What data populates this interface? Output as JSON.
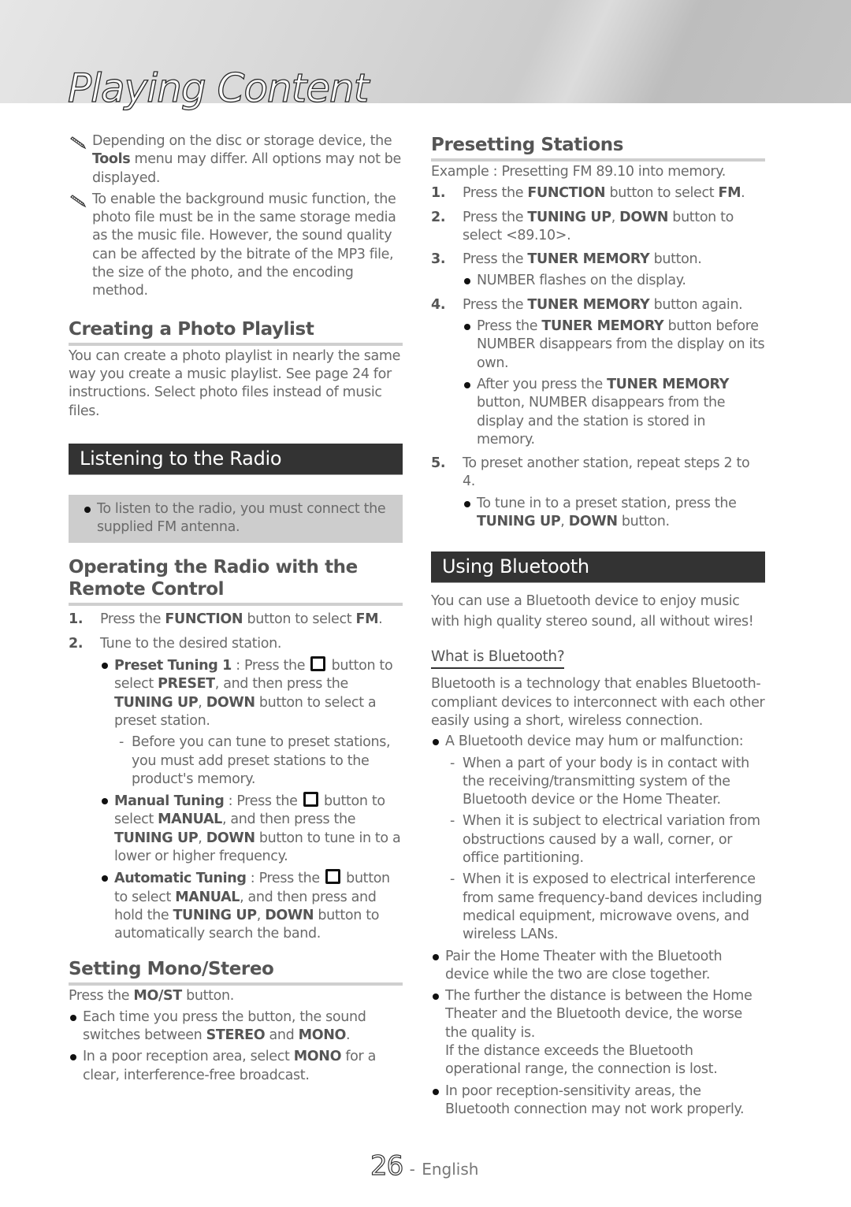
{
  "header": {
    "title": "Playing Content"
  },
  "left": {
    "notes": [
      {
        "parts": [
          [
            "Depending on the disc or storage device, the ",
            ""
          ],
          [
            "Tools",
            "b"
          ],
          [
            " menu may differ. All options may not be displayed.",
            ""
          ]
        ]
      },
      {
        "parts": [
          [
            "To enable the background music function, the photo file must be in the same storage media as the music file. However, the sound quality can be affected by the bitrate of the MP3 file, the size of the photo, and the encoding method.",
            ""
          ]
        ]
      }
    ],
    "photo_playlist": {
      "heading": "Creating a Photo Playlist",
      "body": "You can create a photo playlist in nearly the same way you create a music playlist. See page 24 for instructions. Select photo files instead of music files."
    },
    "radio_section": {
      "title": "Listening to the Radio",
      "note": "To listen to the radio, you must connect the supplied FM antenna."
    },
    "remote": {
      "heading": "Operating the Radio with the Remote Control",
      "steps": [
        {
          "num": "1.",
          "parts": [
            [
              "Press the ",
              ""
            ],
            [
              "FUNCTION",
              "b"
            ],
            [
              " button to select ",
              ""
            ],
            [
              "FM",
              "b"
            ],
            [
              ".",
              ""
            ]
          ]
        },
        {
          "num": "2.",
          "parts": [
            [
              "Tune to the desired station.",
              ""
            ]
          ]
        }
      ],
      "tuning": [
        {
          "label": "Preset Tuning 1",
          "pre": " : Press the ",
          "icon": "square-button-icon",
          "parts": [
            [
              " button to select ",
              ""
            ],
            [
              "PRESET",
              "b"
            ],
            [
              ", and then press the ",
              ""
            ],
            [
              "TUNING UP",
              "b"
            ],
            [
              ", ",
              ""
            ],
            [
              "DOWN",
              "b"
            ],
            [
              " button to select a preset station.",
              ""
            ]
          ],
          "dash": "Before you can tune to preset stations, you must add preset stations to the product's memory."
        },
        {
          "label": "Manual Tuning",
          "pre": " : Press the ",
          "icon": "square-button-icon",
          "parts": [
            [
              " button to select ",
              ""
            ],
            [
              "MANUAL",
              "b"
            ],
            [
              ", and then press the ",
              ""
            ],
            [
              "TUNING UP",
              "b"
            ],
            [
              ", ",
              ""
            ],
            [
              "DOWN",
              "b"
            ],
            [
              " button to tune in to a lower or higher frequency.",
              ""
            ]
          ]
        },
        {
          "label": "Automatic Tuning",
          "pre": " : Press the ",
          "icon": "square-button-icon",
          "parts": [
            [
              " button to select ",
              ""
            ],
            [
              "MANUAL",
              "b"
            ],
            [
              ", and then press and hold the ",
              ""
            ],
            [
              "TUNING UP",
              "b"
            ],
            [
              ", ",
              ""
            ],
            [
              "DOWN",
              "b"
            ],
            [
              " button to automatically search the band.",
              ""
            ]
          ]
        }
      ]
    },
    "mono": {
      "heading": "Setting Mono/Stereo",
      "intro": [
        [
          "Press the ",
          ""
        ],
        [
          "MO/ST",
          "b"
        ],
        [
          " button.",
          ""
        ]
      ],
      "bullets": [
        [
          [
            "Each time you press the button, the sound switches between ",
            ""
          ],
          [
            "STEREO",
            "b"
          ],
          [
            " and ",
            ""
          ],
          [
            "MONO",
            "b"
          ],
          [
            ".",
            ""
          ]
        ],
        [
          [
            "In a poor reception area, select ",
            ""
          ],
          [
            "MONO",
            "b"
          ],
          [
            " for a clear, interference-free broadcast.",
            ""
          ]
        ]
      ]
    }
  },
  "right": {
    "presetting": {
      "heading": "Presetting Stations",
      "example": "Example : Presetting FM 89.10 into memory.",
      "steps": [
        {
          "num": "1.",
          "parts": [
            [
              "Press the ",
              ""
            ],
            [
              "FUNCTION",
              "b"
            ],
            [
              " button to select ",
              ""
            ],
            [
              "FM",
              "b"
            ],
            [
              ".",
              ""
            ]
          ],
          "bullets": []
        },
        {
          "num": "2.",
          "parts": [
            [
              "Press the ",
              ""
            ],
            [
              "TUNING UP",
              "b"
            ],
            [
              ", ",
              ""
            ],
            [
              "DOWN",
              "b"
            ],
            [
              " button to select <89.10>.",
              ""
            ]
          ],
          "bullets": []
        },
        {
          "num": "3.",
          "parts": [
            [
              "Press the ",
              ""
            ],
            [
              "TUNER MEMORY",
              "b"
            ],
            [
              " button.",
              ""
            ]
          ],
          "bullets": [
            [
              [
                "NUMBER flashes on the display.",
                ""
              ]
            ]
          ]
        },
        {
          "num": "4.",
          "parts": [
            [
              "Press the ",
              ""
            ],
            [
              "TUNER MEMORY",
              "b"
            ],
            [
              " button again.",
              ""
            ]
          ],
          "bullets": [
            [
              [
                "Press the ",
                ""
              ],
              [
                "TUNER MEMORY",
                "b"
              ],
              [
                " button before NUMBER disappears from the display on its own.",
                ""
              ]
            ],
            [
              [
                "After you press the ",
                ""
              ],
              [
                "TUNER MEMORY",
                "b"
              ],
              [
                " button, NUMBER disappears from the display and the station is stored in memory.",
                ""
              ]
            ]
          ]
        },
        {
          "num": "5.",
          "parts": [
            [
              "To preset another station, repeat steps 2 to 4.",
              ""
            ]
          ],
          "bullets": [
            [
              [
                "To tune in to a preset station, press the ",
                ""
              ],
              [
                "TUNING UP",
                "b"
              ],
              [
                ", ",
                ""
              ],
              [
                "DOWN",
                "b"
              ],
              [
                " button.",
                ""
              ]
            ]
          ]
        }
      ]
    },
    "bluetooth": {
      "title": "Using Bluetooth",
      "intro": "You can use a Bluetooth device to enjoy music with high quality stereo sound, all without wires!",
      "subheading": "What is Bluetooth?",
      "body": "Bluetooth is a technology that enables Bluetooth-compliant devices to interconnect with each other easily using a short, wireless connection.",
      "malfunction": "A Bluetooth device may hum or malfunction:",
      "dashes": [
        "When a part of your body is in contact with the receiving/transmitting system of the Bluetooth device or the Home Theater.",
        "When it is subject to electrical variation from obstructions caused by a wall, corner, or office partitioning.",
        "When it is exposed to electrical interference from same frequency-band devices including medical equipment, microwave ovens, and wireless LANs."
      ],
      "bullets": [
        "Pair the Home Theater with the Bluetooth device while the two are close together.",
        "The further the distance is between the Home Theater and the Bluetooth device, the worse the quality is.",
        "In poor reception-sensitivity areas, the Bluetooth connection may not work properly."
      ],
      "range_note": "If the distance exceeds the Bluetooth operational range, the connection is lost."
    }
  },
  "footer": {
    "page_number": "26",
    "separator": " - ",
    "language": "English"
  }
}
